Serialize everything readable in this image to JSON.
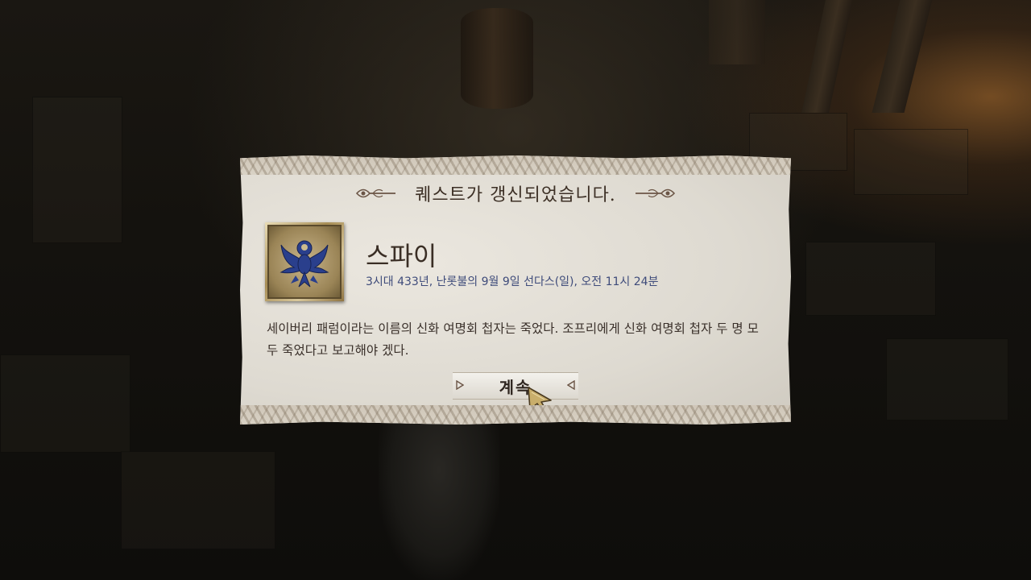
{
  "dialog": {
    "title": "퀘스트가 갱신되었습니다.",
    "quest": {
      "name": "스파이",
      "date": "3시대 433년, 난롯불의 9월 9일 선다스(일), 오전 11시 24분",
      "description": "세이버리 패럼이라는 이름의 신화 여명회 첩자는 죽었다. 조프리에게 신화 여명회 첩자 두 명 모두 죽었다고 보고해야 겠다.",
      "emblem_icon": "phoenix-crest-icon"
    },
    "continue_label": "계속"
  },
  "colors": {
    "title": "#3d3026",
    "date": "#3e4b7a",
    "emblem_blue": "#2a3f8c",
    "parchment": "#dedad1"
  }
}
